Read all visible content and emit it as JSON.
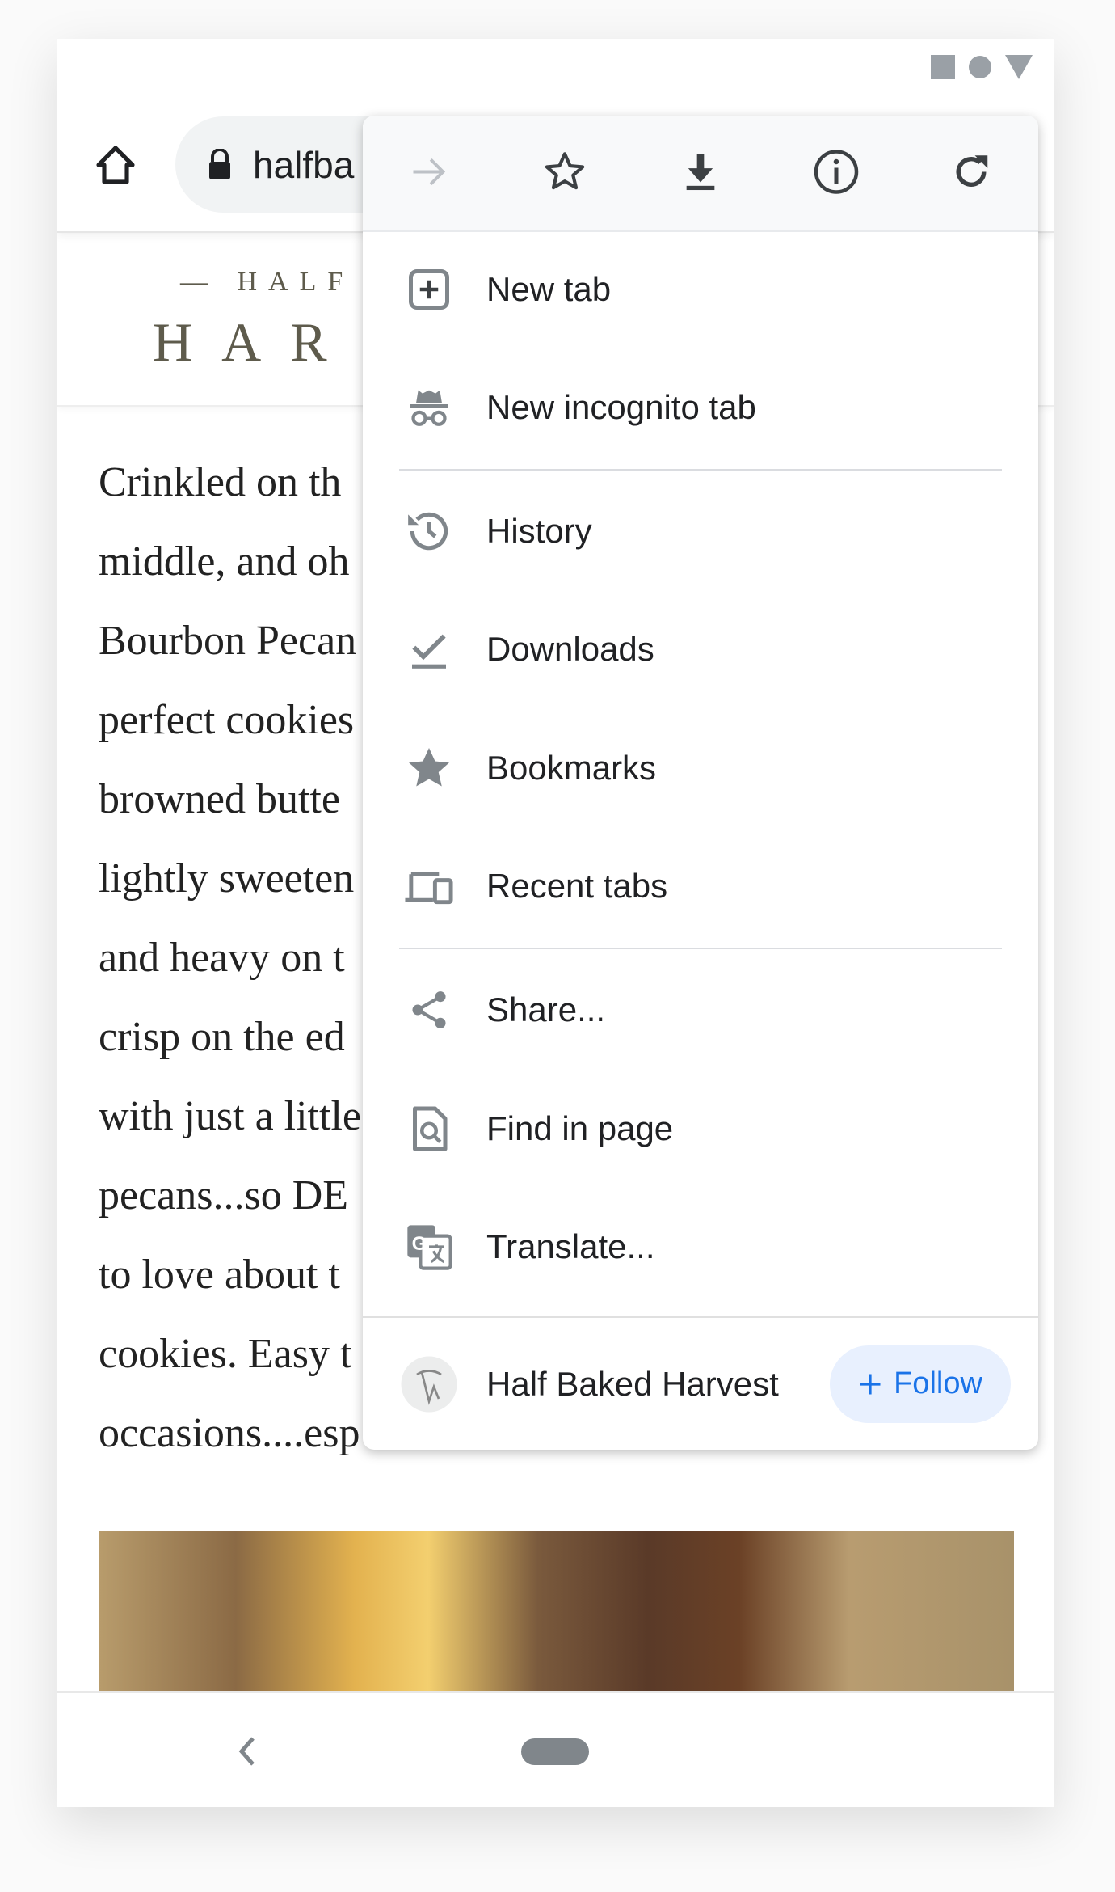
{
  "status_bar": {
    "icons": [
      "square-icon",
      "circle-icon",
      "triangle-icon"
    ]
  },
  "toolbar": {
    "url": "halfba",
    "icons": [
      "home-icon",
      "lock-icon"
    ]
  },
  "site": {
    "logo_top": "— HALF",
    "logo_bottom": "HAR"
  },
  "article": {
    "lines": [
      "Crinkled on th",
      "middle, and oh",
      "Bourbon Pecan",
      "perfect cookies",
      "browned butte",
      "lightly sweeten",
      "and heavy on t",
      "crisp on the ed",
      "with just a little",
      "pecans...so DE",
      "to love about t",
      "cookies. Easy t",
      "occasions....esp"
    ]
  },
  "menu": {
    "toolbar_icons": [
      "forward-icon",
      "bookmark-star-icon",
      "download-icon",
      "info-icon",
      "refresh-icon"
    ],
    "items": [
      {
        "label": "New tab",
        "icon": "new-tab-icon"
      },
      {
        "label": "New incognito tab",
        "icon": "incognito-icon"
      },
      {
        "label": "History",
        "icon": "history-icon"
      },
      {
        "label": "Downloads",
        "icon": "downloads-icon"
      },
      {
        "label": "Bookmarks",
        "icon": "star-icon"
      },
      {
        "label": "Recent tabs",
        "icon": "devices-icon"
      },
      {
        "label": "Share...",
        "icon": "share-icon"
      },
      {
        "label": "Find in page",
        "icon": "find-icon"
      },
      {
        "label": "Translate...",
        "icon": "translate-icon"
      }
    ],
    "footer": {
      "site_name": "Half Baked Harvest",
      "follow_label": "Follow",
      "follow_color": "#1a73e8"
    }
  }
}
